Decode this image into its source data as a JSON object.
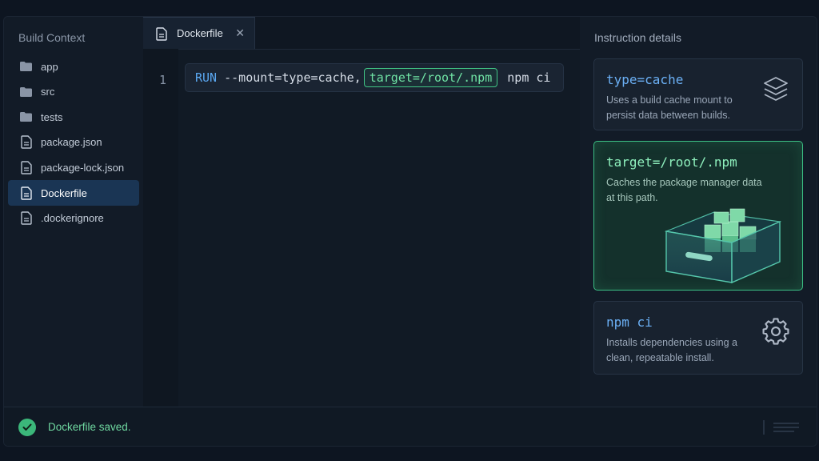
{
  "sidebar": {
    "title": "Build Context",
    "items": [
      {
        "label": "app",
        "icon": "folder-icon",
        "active": false
      },
      {
        "label": "src",
        "icon": "folder-icon",
        "active": false
      },
      {
        "label": "tests",
        "icon": "folder-icon",
        "active": false
      },
      {
        "label": "package.json",
        "icon": "file-icon",
        "active": false
      },
      {
        "label": "package-lock.json",
        "icon": "file-icon",
        "active": false
      },
      {
        "label": "Dockerfile",
        "icon": "file-icon",
        "active": true
      },
      {
        "label": ".dockerignore",
        "icon": "file-icon",
        "active": false
      }
    ]
  },
  "editor": {
    "tab_label": "Dockerfile",
    "close_glyph": "✕",
    "line_number": "1",
    "code": {
      "keyword": "RUN",
      "before": " --mount=type=cache,",
      "highlight": "target=/root/.npm",
      "after": " npm ci"
    }
  },
  "panel": {
    "title": "Instruction details",
    "cards": [
      {
        "term": "type=cache",
        "desc": "Uses a build cache mount to persist data between builds.",
        "icon": "layers-icon"
      },
      {
        "term": "target=/root/.npm",
        "desc": "Caches the package manager data at this path.",
        "icon": "cache-drawer-illustration"
      },
      {
        "term": "npm ci",
        "desc": "Installs dependencies using a clean, repeatable install.",
        "icon": "gear-icon"
      }
    ]
  },
  "status": {
    "text": "Dockerfile saved.",
    "color_ok": "#3bb77a"
  }
}
